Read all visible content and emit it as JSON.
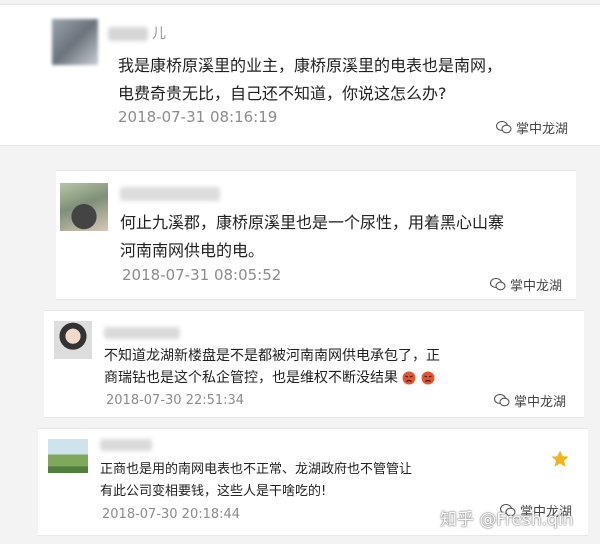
{
  "comments": [
    {
      "text_line1": "我是康桥原溪里的业主，康桥原溪里的电表也是南网，",
      "text_line2": "电费奇贵无比，自己还不知道，你说这怎么办?",
      "time": "2018-07-31 08:16:19",
      "source": "掌中龙湖",
      "name_fragment": "儿"
    },
    {
      "text_line1": "何止九溪郡，康桥原溪里也是一个尿性，用着黑心山寨",
      "text_line2": "河南南网供电的电。",
      "time": "2018-07-31 08:05:52",
      "source": "掌中龙湖"
    },
    {
      "text_line1": "不知道龙湖新楼盘是不是都被河南南网供电承包了，正",
      "text_line2": "商瑞钻也是这个私企管控，也是维权不断没结果",
      "time": "2018-07-30 22:51:34",
      "source": "掌中龙湖"
    },
    {
      "text_line1": "正商也是用的南网电表也不正常、龙湖政府也不管管让",
      "text_line2": "有此公司变相要钱，这些人是干啥吃的!",
      "time": "2018-07-30 20:18:44",
      "source": "掌中龙湖"
    }
  ],
  "watermark": "知乎 @Fresh.qin"
}
